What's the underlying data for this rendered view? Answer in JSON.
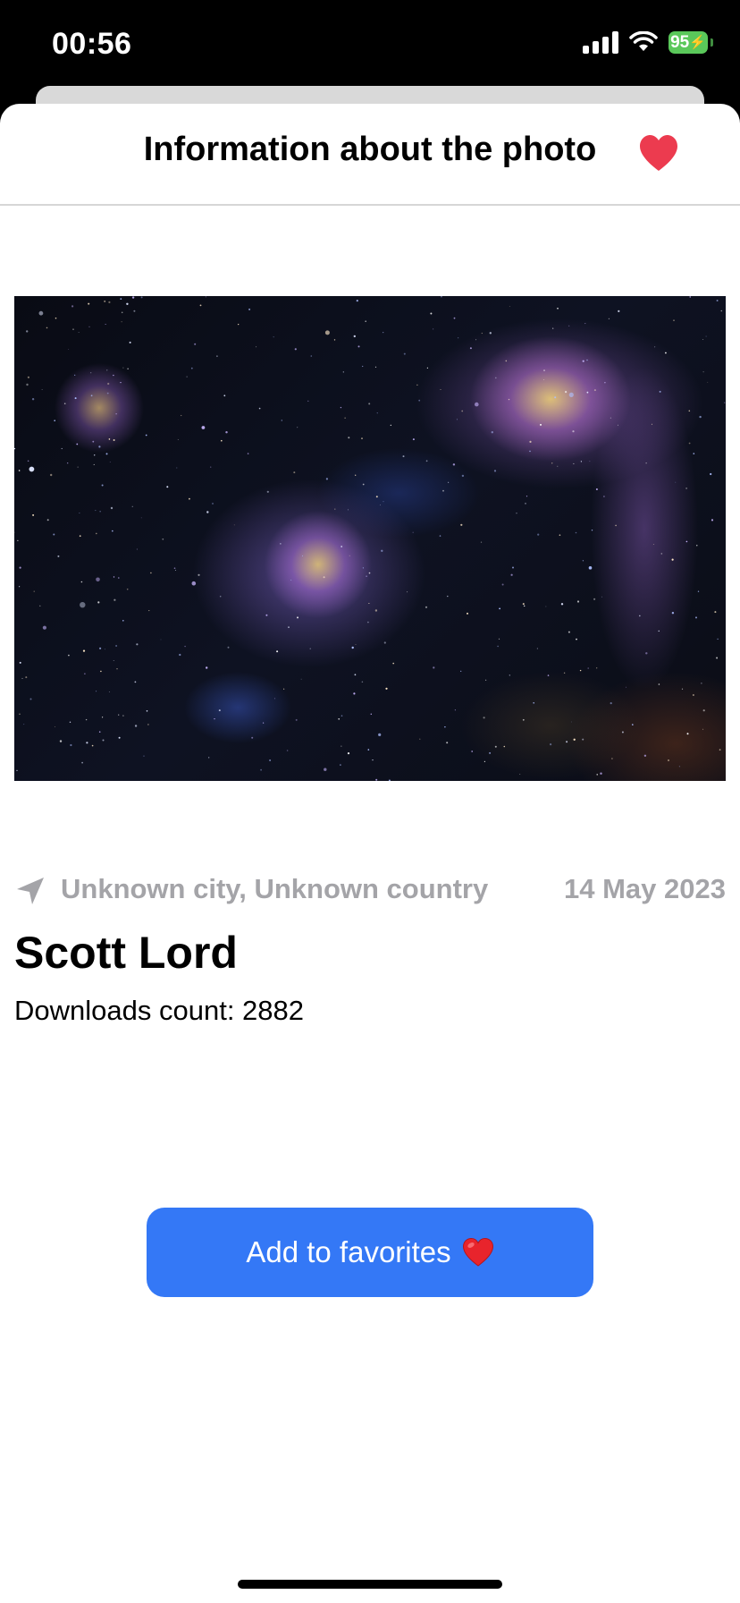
{
  "status_bar": {
    "time": "00:56",
    "battery": "95",
    "icons": [
      "signal-icon",
      "wifi-icon",
      "battery-charging-icon"
    ]
  },
  "nav": {
    "title": "Information about the photo",
    "favorite_icon": "heart-icon",
    "favorite_color": "#ec3b4f"
  },
  "photo": {
    "subject": "nebula-star-field-photo"
  },
  "details": {
    "location_icon": "location-arrow-icon",
    "location": "Unknown city, Unknown country",
    "date": "14 May 2023",
    "author": "Scott Lord",
    "downloads": "Downloads count: 2882"
  },
  "actions": {
    "add_to_favorites": "Add to favorites",
    "button_color": "#3478f6"
  }
}
